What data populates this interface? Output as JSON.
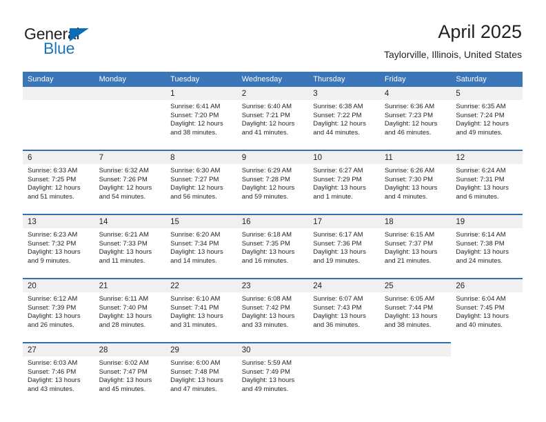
{
  "brand": {
    "name_dark": "General",
    "name_blue": "Blue",
    "accent_color": "#1b75bc",
    "triangle_color": "#0b6db8"
  },
  "header": {
    "title": "April 2025",
    "subtitle": "Taylorville, Illinois, United States",
    "header_bg": "#3a76b8",
    "band_bg": "#f0f0f0",
    "rule_color": "#2f6fb0"
  },
  "weekdays": [
    "Sunday",
    "Monday",
    "Tuesday",
    "Wednesday",
    "Thursday",
    "Friday",
    "Saturday"
  ],
  "weeks": [
    [
      {
        "day": "",
        "empty": true
      },
      {
        "day": "",
        "empty": true
      },
      {
        "day": "1",
        "sunrise": "Sunrise: 6:41 AM",
        "sunset": "Sunset: 7:20 PM",
        "daylight1": "Daylight: 12 hours",
        "daylight2": "and 38 minutes."
      },
      {
        "day": "2",
        "sunrise": "Sunrise: 6:40 AM",
        "sunset": "Sunset: 7:21 PM",
        "daylight1": "Daylight: 12 hours",
        "daylight2": "and 41 minutes."
      },
      {
        "day": "3",
        "sunrise": "Sunrise: 6:38 AM",
        "sunset": "Sunset: 7:22 PM",
        "daylight1": "Daylight: 12 hours",
        "daylight2": "and 44 minutes."
      },
      {
        "day": "4",
        "sunrise": "Sunrise: 6:36 AM",
        "sunset": "Sunset: 7:23 PM",
        "daylight1": "Daylight: 12 hours",
        "daylight2": "and 46 minutes."
      },
      {
        "day": "5",
        "sunrise": "Sunrise: 6:35 AM",
        "sunset": "Sunset: 7:24 PM",
        "daylight1": "Daylight: 12 hours",
        "daylight2": "and 49 minutes."
      }
    ],
    [
      {
        "day": "6",
        "sunrise": "Sunrise: 6:33 AM",
        "sunset": "Sunset: 7:25 PM",
        "daylight1": "Daylight: 12 hours",
        "daylight2": "and 51 minutes."
      },
      {
        "day": "7",
        "sunrise": "Sunrise: 6:32 AM",
        "sunset": "Sunset: 7:26 PM",
        "daylight1": "Daylight: 12 hours",
        "daylight2": "and 54 minutes."
      },
      {
        "day": "8",
        "sunrise": "Sunrise: 6:30 AM",
        "sunset": "Sunset: 7:27 PM",
        "daylight1": "Daylight: 12 hours",
        "daylight2": "and 56 minutes."
      },
      {
        "day": "9",
        "sunrise": "Sunrise: 6:29 AM",
        "sunset": "Sunset: 7:28 PM",
        "daylight1": "Daylight: 12 hours",
        "daylight2": "and 59 minutes."
      },
      {
        "day": "10",
        "sunrise": "Sunrise: 6:27 AM",
        "sunset": "Sunset: 7:29 PM",
        "daylight1": "Daylight: 13 hours",
        "daylight2": "and 1 minute."
      },
      {
        "day": "11",
        "sunrise": "Sunrise: 6:26 AM",
        "sunset": "Sunset: 7:30 PM",
        "daylight1": "Daylight: 13 hours",
        "daylight2": "and 4 minutes."
      },
      {
        "day": "12",
        "sunrise": "Sunrise: 6:24 AM",
        "sunset": "Sunset: 7:31 PM",
        "daylight1": "Daylight: 13 hours",
        "daylight2": "and 6 minutes."
      }
    ],
    [
      {
        "day": "13",
        "sunrise": "Sunrise: 6:23 AM",
        "sunset": "Sunset: 7:32 PM",
        "daylight1": "Daylight: 13 hours",
        "daylight2": "and 9 minutes."
      },
      {
        "day": "14",
        "sunrise": "Sunrise: 6:21 AM",
        "sunset": "Sunset: 7:33 PM",
        "daylight1": "Daylight: 13 hours",
        "daylight2": "and 11 minutes."
      },
      {
        "day": "15",
        "sunrise": "Sunrise: 6:20 AM",
        "sunset": "Sunset: 7:34 PM",
        "daylight1": "Daylight: 13 hours",
        "daylight2": "and 14 minutes."
      },
      {
        "day": "16",
        "sunrise": "Sunrise: 6:18 AM",
        "sunset": "Sunset: 7:35 PM",
        "daylight1": "Daylight: 13 hours",
        "daylight2": "and 16 minutes."
      },
      {
        "day": "17",
        "sunrise": "Sunrise: 6:17 AM",
        "sunset": "Sunset: 7:36 PM",
        "daylight1": "Daylight: 13 hours",
        "daylight2": "and 19 minutes."
      },
      {
        "day": "18",
        "sunrise": "Sunrise: 6:15 AM",
        "sunset": "Sunset: 7:37 PM",
        "daylight1": "Daylight: 13 hours",
        "daylight2": "and 21 minutes."
      },
      {
        "day": "19",
        "sunrise": "Sunrise: 6:14 AM",
        "sunset": "Sunset: 7:38 PM",
        "daylight1": "Daylight: 13 hours",
        "daylight2": "and 24 minutes."
      }
    ],
    [
      {
        "day": "20",
        "sunrise": "Sunrise: 6:12 AM",
        "sunset": "Sunset: 7:39 PM",
        "daylight1": "Daylight: 13 hours",
        "daylight2": "and 26 minutes."
      },
      {
        "day": "21",
        "sunrise": "Sunrise: 6:11 AM",
        "sunset": "Sunset: 7:40 PM",
        "daylight1": "Daylight: 13 hours",
        "daylight2": "and 28 minutes."
      },
      {
        "day": "22",
        "sunrise": "Sunrise: 6:10 AM",
        "sunset": "Sunset: 7:41 PM",
        "daylight1": "Daylight: 13 hours",
        "daylight2": "and 31 minutes."
      },
      {
        "day": "23",
        "sunrise": "Sunrise: 6:08 AM",
        "sunset": "Sunset: 7:42 PM",
        "daylight1": "Daylight: 13 hours",
        "daylight2": "and 33 minutes."
      },
      {
        "day": "24",
        "sunrise": "Sunrise: 6:07 AM",
        "sunset": "Sunset: 7:43 PM",
        "daylight1": "Daylight: 13 hours",
        "daylight2": "and 36 minutes."
      },
      {
        "day": "25",
        "sunrise": "Sunrise: 6:05 AM",
        "sunset": "Sunset: 7:44 PM",
        "daylight1": "Daylight: 13 hours",
        "daylight2": "and 38 minutes."
      },
      {
        "day": "26",
        "sunrise": "Sunrise: 6:04 AM",
        "sunset": "Sunset: 7:45 PM",
        "daylight1": "Daylight: 13 hours",
        "daylight2": "and 40 minutes."
      }
    ],
    [
      {
        "day": "27",
        "sunrise": "Sunrise: 6:03 AM",
        "sunset": "Sunset: 7:46 PM",
        "daylight1": "Daylight: 13 hours",
        "daylight2": "and 43 minutes."
      },
      {
        "day": "28",
        "sunrise": "Sunrise: 6:02 AM",
        "sunset": "Sunset: 7:47 PM",
        "daylight1": "Daylight: 13 hours",
        "daylight2": "and 45 minutes."
      },
      {
        "day": "29",
        "sunrise": "Sunrise: 6:00 AM",
        "sunset": "Sunset: 7:48 PM",
        "daylight1": "Daylight: 13 hours",
        "daylight2": "and 47 minutes."
      },
      {
        "day": "30",
        "sunrise": "Sunrise: 5:59 AM",
        "sunset": "Sunset: 7:49 PM",
        "daylight1": "Daylight: 13 hours",
        "daylight2": "and 49 minutes."
      },
      {
        "day": "",
        "empty": true
      },
      {
        "day": "",
        "empty": true
      },
      {
        "day": "",
        "empty": true,
        "outside": true
      }
    ]
  ]
}
